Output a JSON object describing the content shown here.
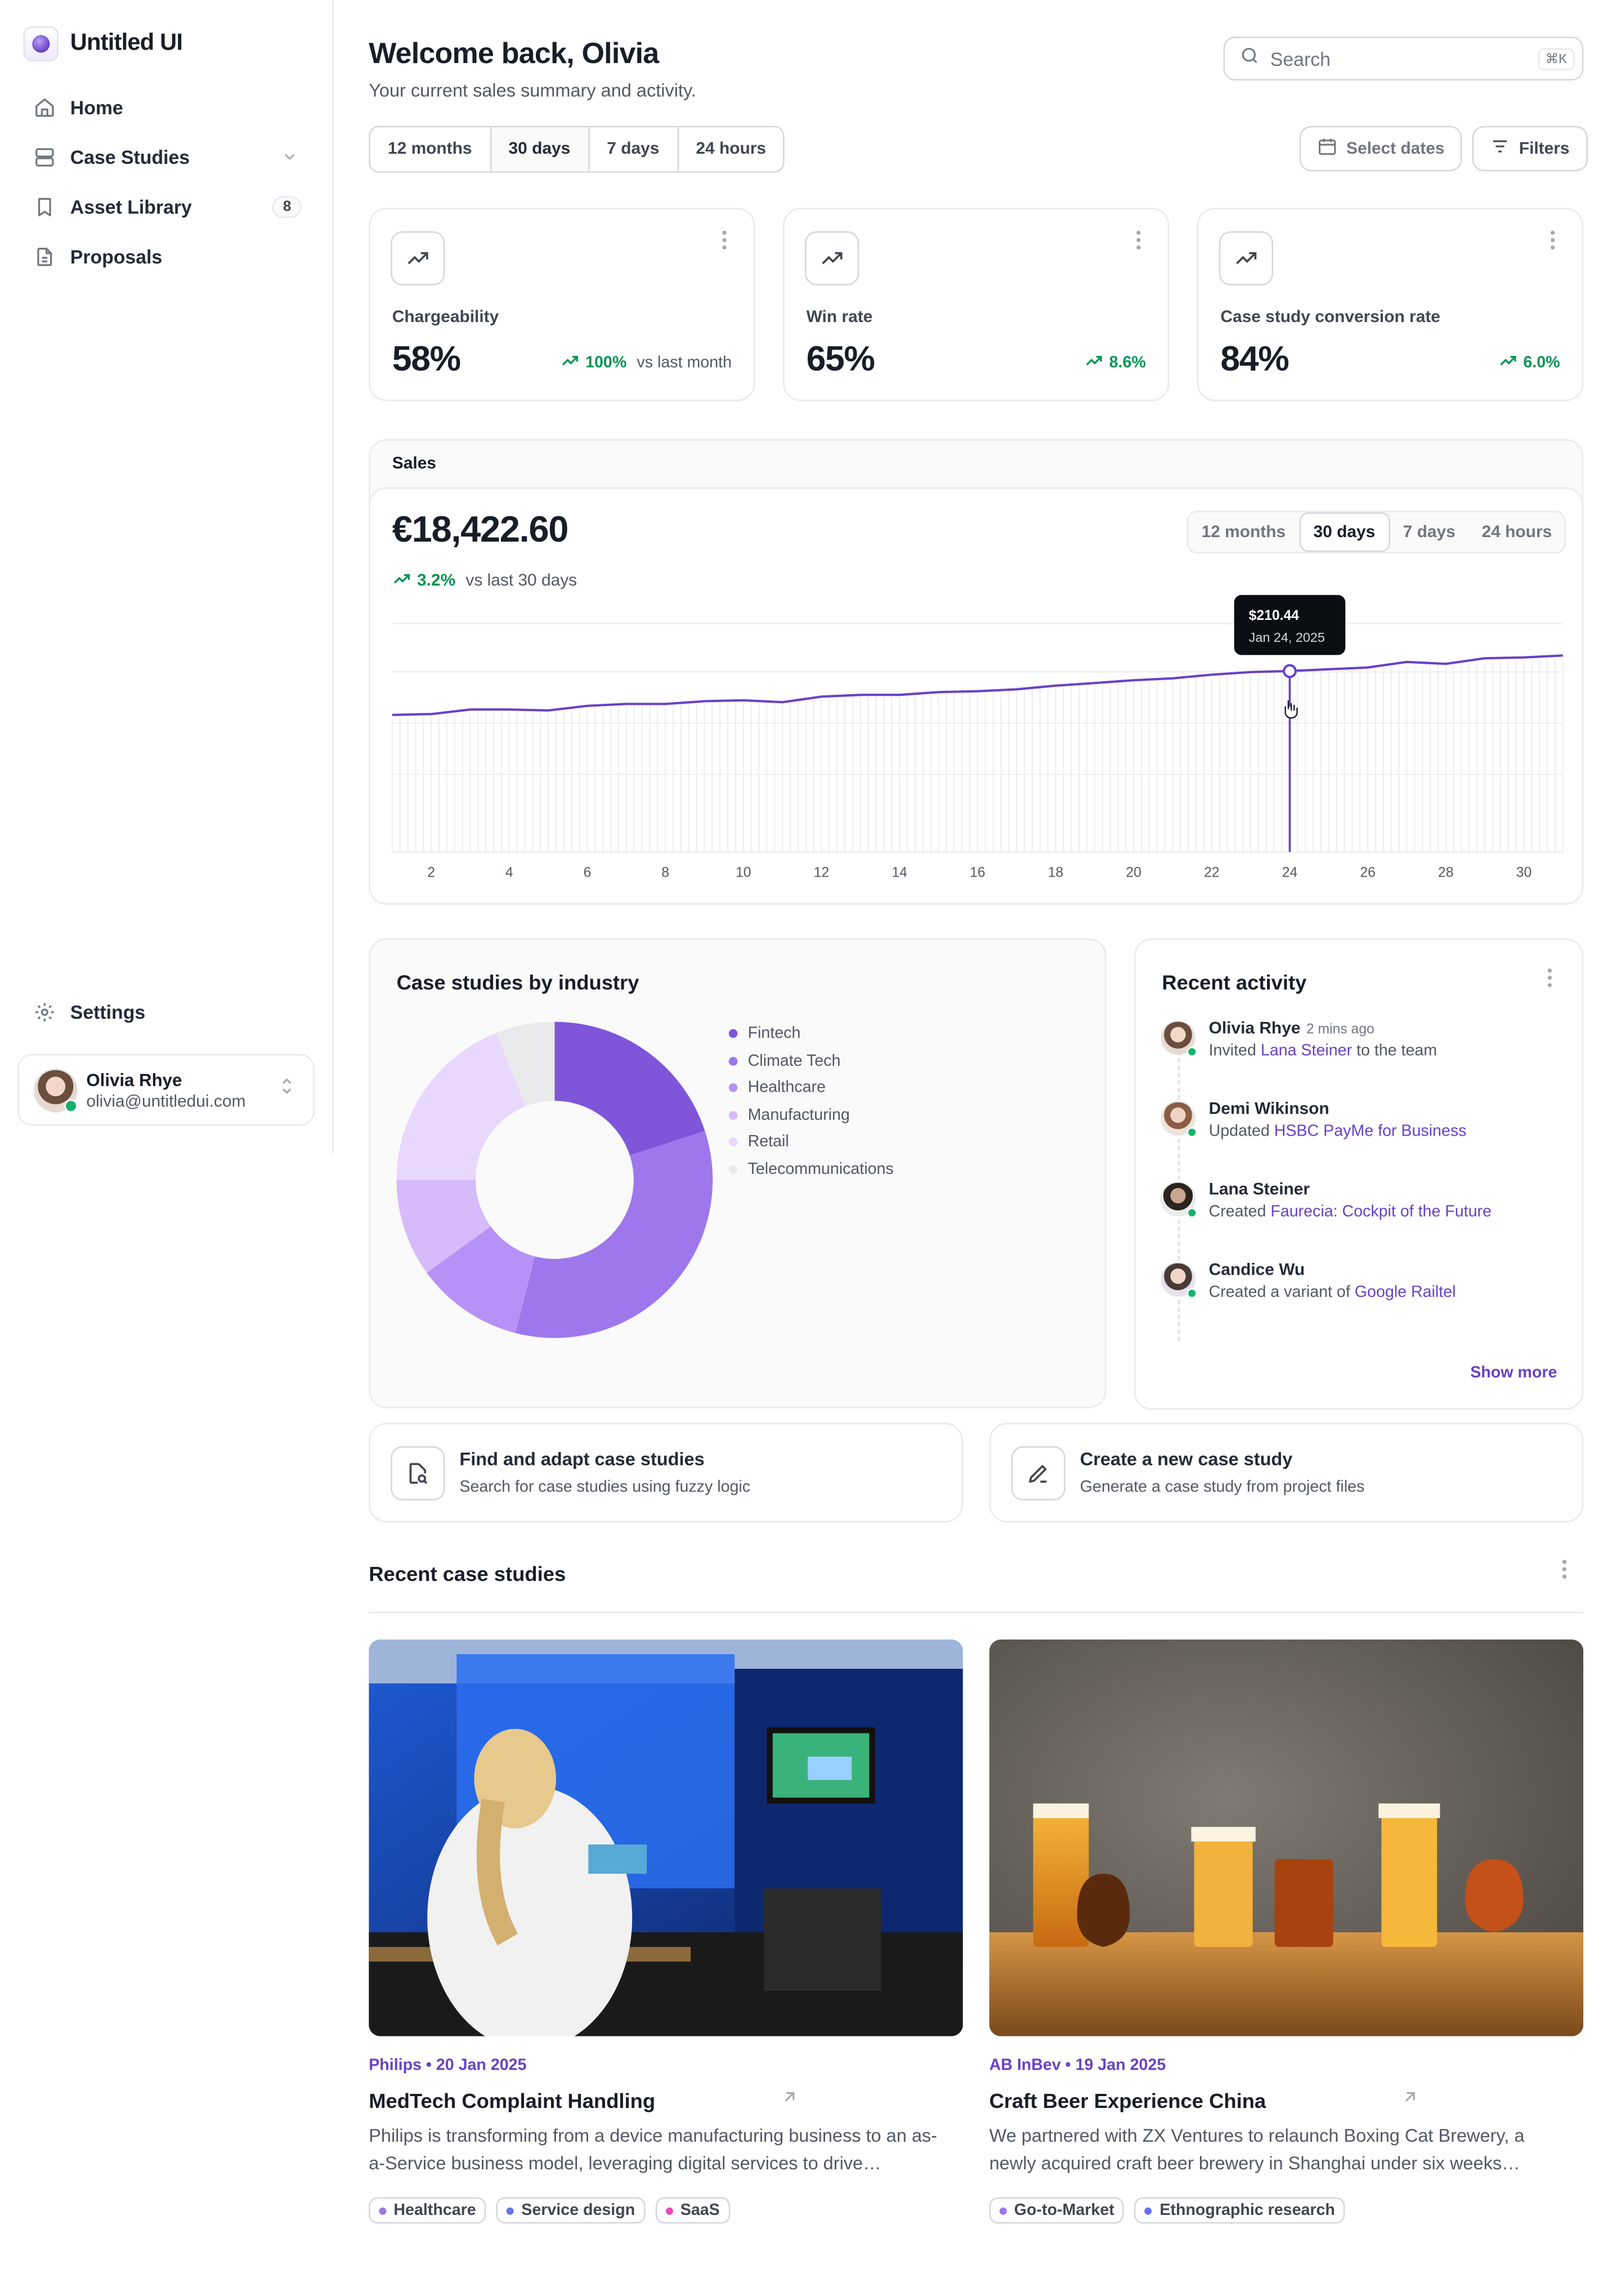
{
  "brand": {
    "name": "Untitled UI"
  },
  "nav": {
    "items": [
      {
        "label": "Home"
      },
      {
        "label": "Case Studies"
      },
      {
        "label": "Asset Library",
        "badge": "8"
      },
      {
        "label": "Proposals"
      }
    ],
    "settings": "Settings"
  },
  "user": {
    "name": "Olivia Rhye",
    "email": "olivia@untitledui.com"
  },
  "header": {
    "title": "Welcome back, Olivia",
    "subtitle": "Your current sales summary and activity.",
    "search_placeholder": "Search",
    "search_shortcut": "⌘K"
  },
  "range_tabs": [
    "12 months",
    "30 days",
    "7 days",
    "24 hours"
  ],
  "active_range": "30 days",
  "buttons": {
    "select_dates": "Select dates",
    "filters": "Filters"
  },
  "metrics": [
    {
      "label": "Chargeability",
      "value": "58%",
      "trend": "100%",
      "note": "vs last month"
    },
    {
      "label": "Win rate",
      "value": "65%",
      "trend": "8.6%",
      "note": ""
    },
    {
      "label": "Case study conversion rate",
      "value": "84%",
      "trend": "6.0%",
      "note": ""
    }
  ],
  "sales": {
    "header": "Sales",
    "value": "€18,422.60",
    "trend": "3.2%",
    "trend_note": "vs last 30 days",
    "tooltip": {
      "value": "$210.44",
      "date": "Jan 24, 2025"
    }
  },
  "chart_data": {
    "type": "line",
    "x_ticks": [
      "2",
      "4",
      "6",
      "8",
      "10",
      "12",
      "14",
      "16",
      "18",
      "20",
      "22",
      "24",
      "26",
      "28",
      "30"
    ],
    "x": [
      1,
      2,
      3,
      4,
      5,
      6,
      7,
      8,
      9,
      10,
      11,
      12,
      13,
      14,
      15,
      16,
      17,
      18,
      19,
      20,
      21,
      22,
      23,
      24,
      25,
      26,
      27,
      28,
      29,
      30,
      31
    ],
    "series": [
      {
        "values": [
          150,
          151,
          156,
          156,
          155,
          160,
          162,
          162,
          165,
          166,
          164,
          170,
          172,
          172,
          175,
          176,
          178,
          182,
          185,
          188,
          190,
          194,
          197,
          198,
          200,
          202,
          208,
          206,
          212,
          213,
          215
        ]
      }
    ],
    "highlight": {
      "x": 24,
      "label": "$210.44",
      "date": "Jan 24, 2025"
    },
    "grid": true,
    "color": "#6941c6"
  },
  "industry": {
    "title": "Case studies by industry",
    "chart_data": {
      "type": "pie",
      "labels": [
        "Fintech",
        "Climate Tech",
        "Healthcare",
        "Manufacturing",
        "Retail",
        "Telecommunications"
      ],
      "values": [
        20,
        34,
        11,
        10,
        19,
        6
      ],
      "colors": [
        "#7f56d9",
        "#9e77ed",
        "#b692f6",
        "#d6bbfb",
        "#e9d7fe",
        "#e9eaeb"
      ]
    }
  },
  "activity": {
    "title": "Recent activity",
    "items": [
      {
        "name": "Olivia Rhye",
        "time": "2 mins ago",
        "action": "Invited",
        "link": "Lana Steiner",
        "suffix": "to the team"
      },
      {
        "name": "Demi Wikinson",
        "time": "",
        "action": "Updated",
        "link": "HSBC PayMe for Business",
        "suffix": ""
      },
      {
        "name": "Lana Steiner",
        "time": "",
        "action": "Created",
        "link": "Faurecia: Cockpit of the Future",
        "suffix": ""
      },
      {
        "name": "Candice Wu",
        "time": "",
        "action": "Created a variant of",
        "link": "Google Railtel",
        "suffix": ""
      }
    ],
    "show_more": "Show more"
  },
  "actions": [
    {
      "title": "Find and adapt case studies",
      "desc": "Search for case studies using fuzzy logic",
      "icon": "file-search-icon"
    },
    {
      "title": "Create a new case study",
      "desc": "Generate a case study from project files",
      "icon": "pen-icon"
    }
  ],
  "recent_case_studies": {
    "title": "Recent case studies",
    "items": [
      {
        "meta": "Philips • 20 Jan 2025",
        "title": "MedTech Complaint Handling",
        "desc": "Philips is transforming from a device manufacturing business to an as-a-Service business model, leveraging digital services to drive…",
        "tags": [
          {
            "label": "Healthcare",
            "color": "#9e77ed"
          },
          {
            "label": "Service design",
            "color": "#6172f3"
          },
          {
            "label": "SaaS",
            "color": "#ee46bc"
          }
        ]
      },
      {
        "meta": "AB InBev • 19 Jan 2025",
        "title": "Craft Beer Experience China",
        "desc": "We partnered with ZX Ventures to relaunch Boxing Cat Brewery, a newly acquired craft beer brewery in Shanghai under six weeks…",
        "tags": [
          {
            "label": "Go-to-Market",
            "color": "#9e77ed"
          },
          {
            "label": "Ethnographic research",
            "color": "#6172f3"
          }
        ]
      }
    ]
  }
}
